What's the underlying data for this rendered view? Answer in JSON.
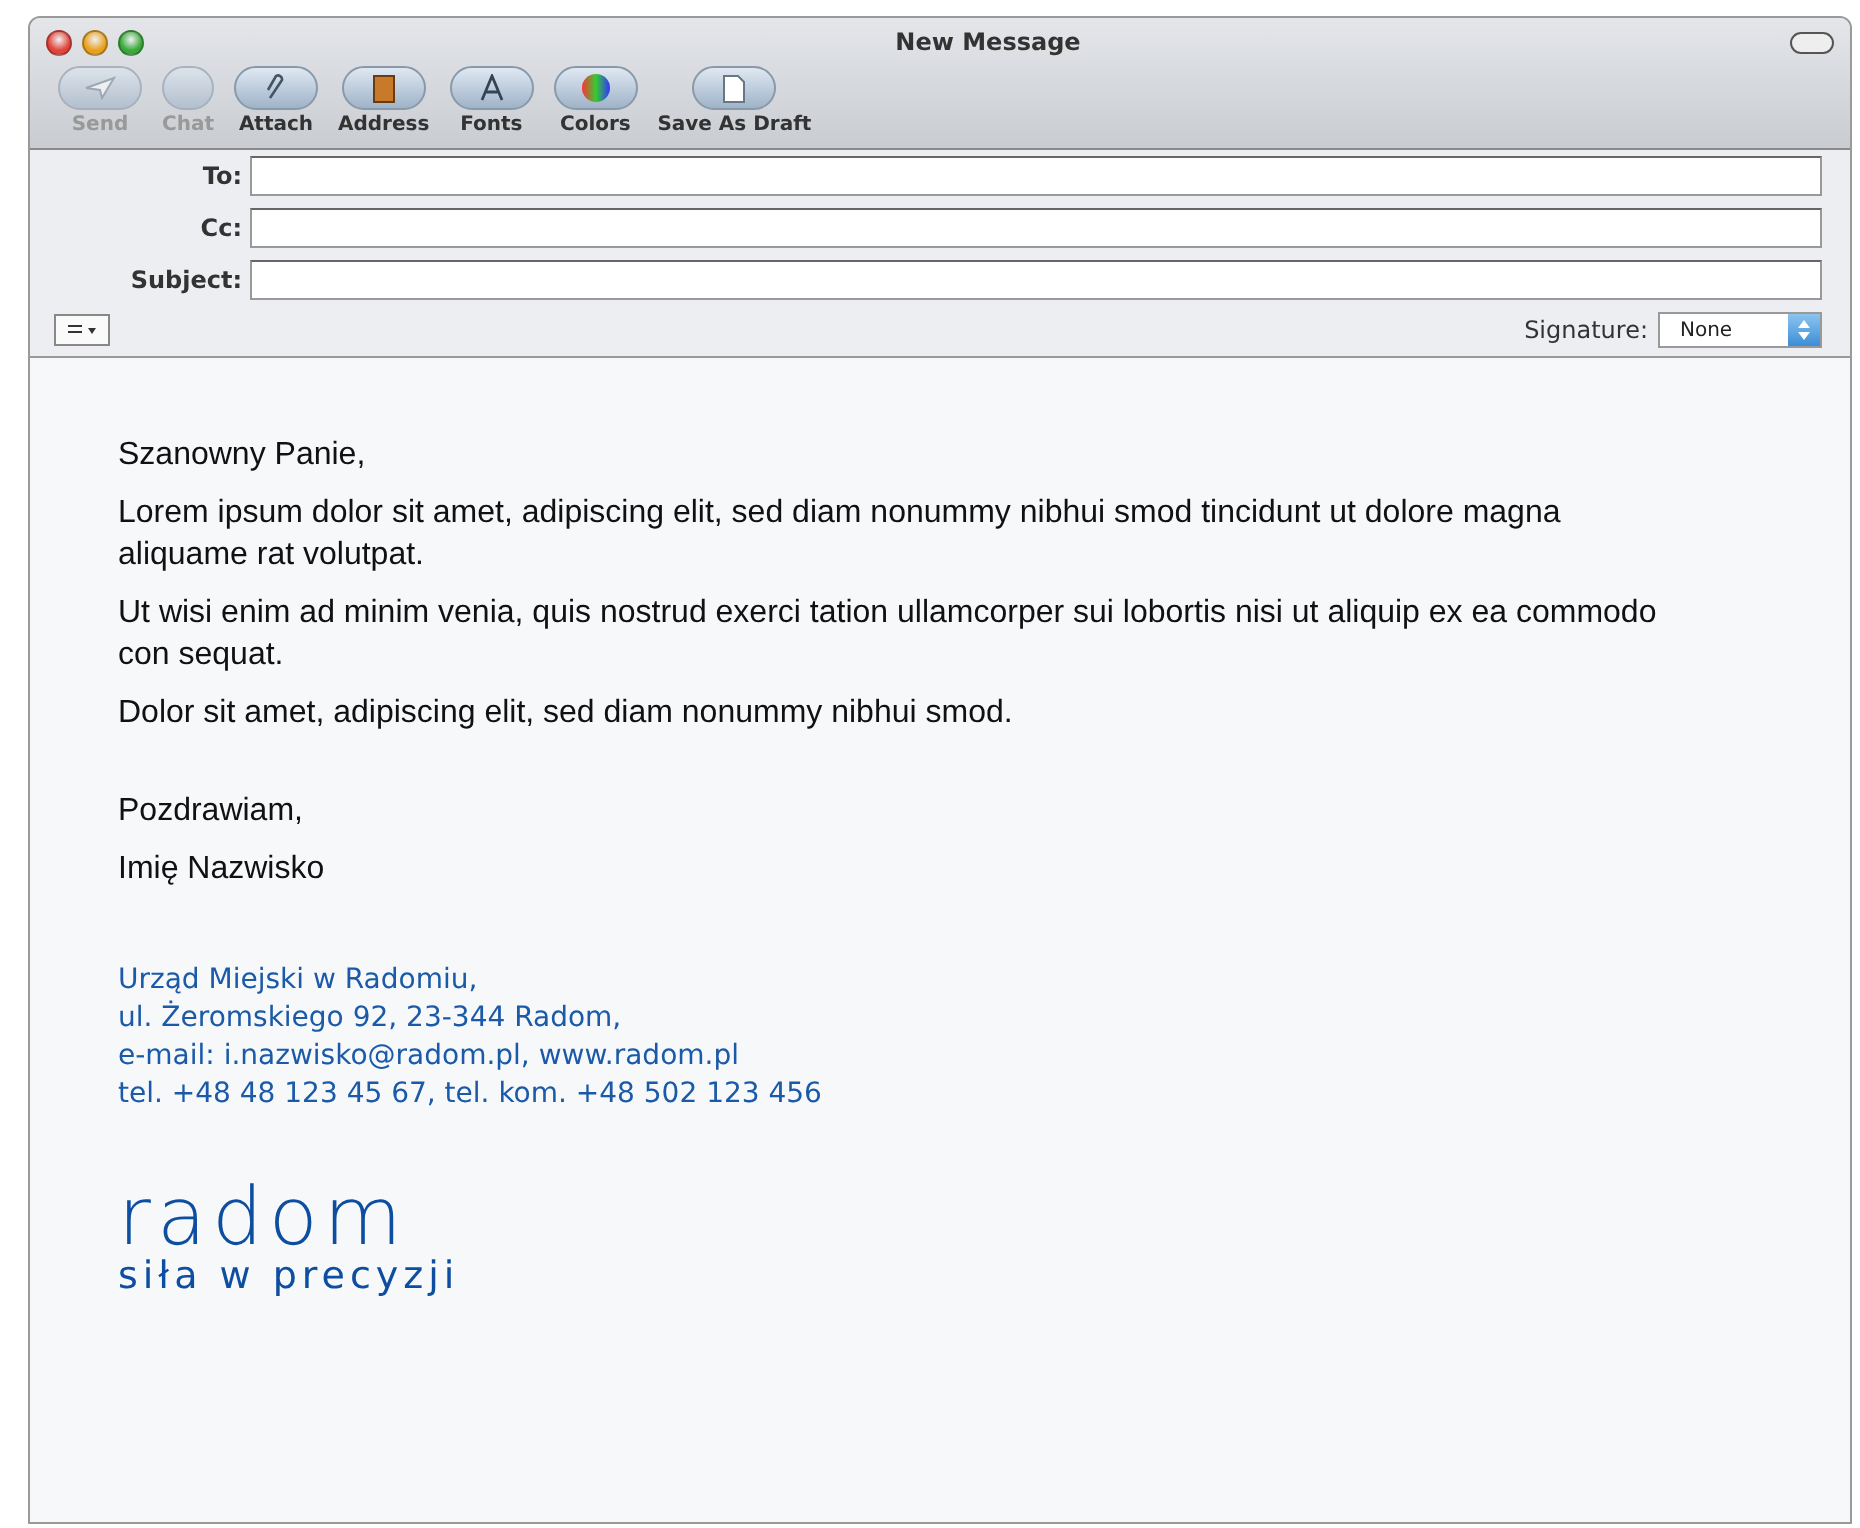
{
  "window": {
    "title": "New Message"
  },
  "toolbar": [
    {
      "label": "Send",
      "disabled": true
    },
    {
      "label": "Chat",
      "disabled": true
    },
    {
      "label": "Attach",
      "disabled": false
    },
    {
      "label": "Address",
      "disabled": false
    },
    {
      "label": "Fonts",
      "disabled": false
    },
    {
      "label": "Colors",
      "disabled": false
    },
    {
      "label": "Save As Draft",
      "disabled": false
    }
  ],
  "header_fields": [
    {
      "label": "To:"
    },
    {
      "label": "Cc:"
    },
    {
      "label": "Subject:"
    }
  ],
  "signature": {
    "label": "Signature:",
    "value": "None"
  },
  "body": {
    "greeting": "Szanowny Panie,",
    "paragraphs": [
      "Lorem ipsum dolor sit amet, adipiscing elit, sed diam nonummy nibhui smod tincidunt ut dolore magna aliquame rat volutpat.",
      "Ut wisi enim ad minim venia, quis nostrud exerci tation ullamcorper sui lobortis nisi ut aliquip ex ea commodo con sequat.",
      "Dolor sit amet, adipiscing elit, sed diam nonummy nibhui smod."
    ],
    "closing": "Pozdrawiam,",
    "name": "Imię Nazwisko"
  },
  "contact": [
    "Urząd Miejski w Radomiu,",
    "ul. Żeromskiego 92, 23-344 Radom,",
    "e-mail: i.nazwisko@radom.pl, www.radom.pl",
    "tel. +48 48 123 45 67, tel. kom. +48 502 123 456"
  ],
  "logo": {
    "wordmark": "radom",
    "tagline": "siła w precyzji"
  }
}
